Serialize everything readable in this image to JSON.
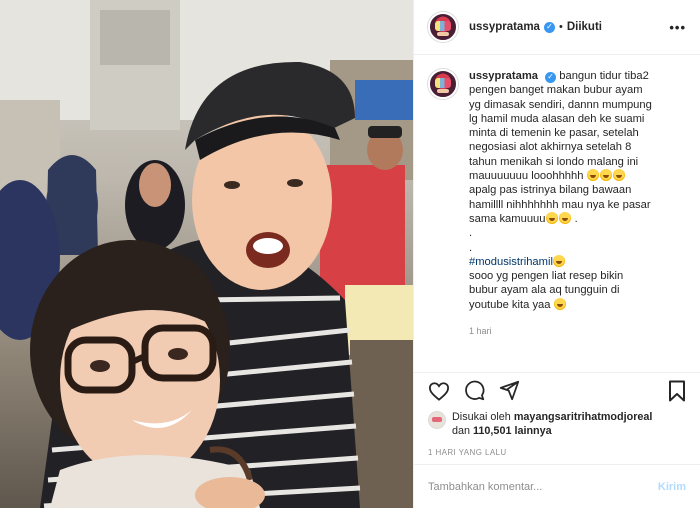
{
  "post": {
    "username": "ussypratama",
    "follow_status": "Diikuti",
    "more_glyph": "•••",
    "separator": "•",
    "verified_glyph": "✓"
  },
  "caption": {
    "username": "ussypratama",
    "lines": [
      "bangun tidur tiba2",
      "pengen banget makan bubur ayam",
      "yg dimasak sendiri, dannn mumpung",
      "lg hamil muda alasan deh ke suami",
      "minta di temenin ke pasar, setelah",
      "negosiasi alot akhirnya setelah 8",
      "tahun menikah si londo malang ini",
      "mauuuuuuu looohhhhh",
      "apalg pas istrinya bilang bawaan",
      "hamillll nihhhhhhh mau nya ke pasar",
      "sama kamuuuu",
      ".",
      ".",
      "#modusistrihamil",
      "sooo yg pengen liat resep bikin",
      "bubur ayam ala aq tungguin di",
      "youtube kita yaa"
    ],
    "age": "1 hari"
  },
  "icons": {
    "like": "heart-icon",
    "comment": "comment-icon",
    "share": "share-icon",
    "save": "bookmark-icon",
    "verified": "verified-badge-icon"
  },
  "likes": {
    "prefix": "Disukai oleh",
    "liker": "mayangsaritrihatmodjoreal",
    "middle": "dan",
    "count": "110,501",
    "suffix": "lainnya"
  },
  "date": "1 HARI YANG LALU",
  "comment_box": {
    "placeholder": "Tambahkan komentar...",
    "post_label": "Kirim"
  },
  "colors": {
    "verified": "#3897f0",
    "hashtag": "#00376b",
    "secondary_text": "#8e8e8e",
    "post_button_disabled": "#b3dbff"
  }
}
